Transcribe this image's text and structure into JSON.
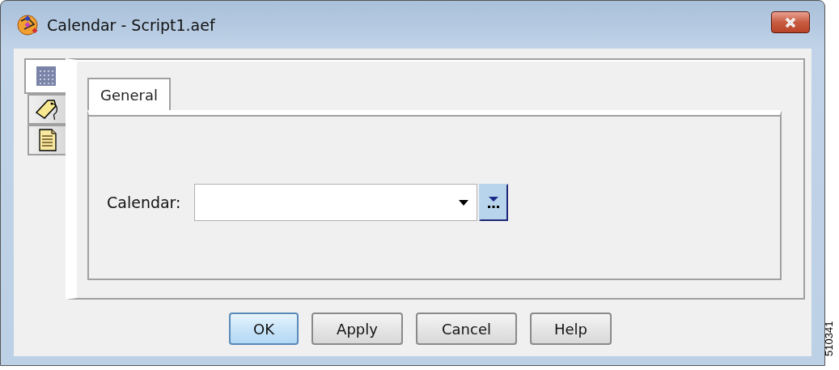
{
  "window": {
    "title": "Calendar - Script1.aef"
  },
  "side_tabs": [
    {
      "kind": "grid",
      "selected": true
    },
    {
      "kind": "tag",
      "selected": false
    },
    {
      "kind": "notes",
      "selected": false
    }
  ],
  "tabs": [
    {
      "label": "General",
      "selected": true
    }
  ],
  "calendar_field": {
    "label": "Calendar:",
    "browse_highlighted": true
  },
  "buttons": [
    {
      "label": "OK",
      "default": true
    },
    {
      "label": "Apply",
      "default": false
    },
    {
      "label": "Cancel",
      "default": false
    },
    {
      "label": "Help",
      "default": false
    }
  ],
  "figure_number": "510341"
}
